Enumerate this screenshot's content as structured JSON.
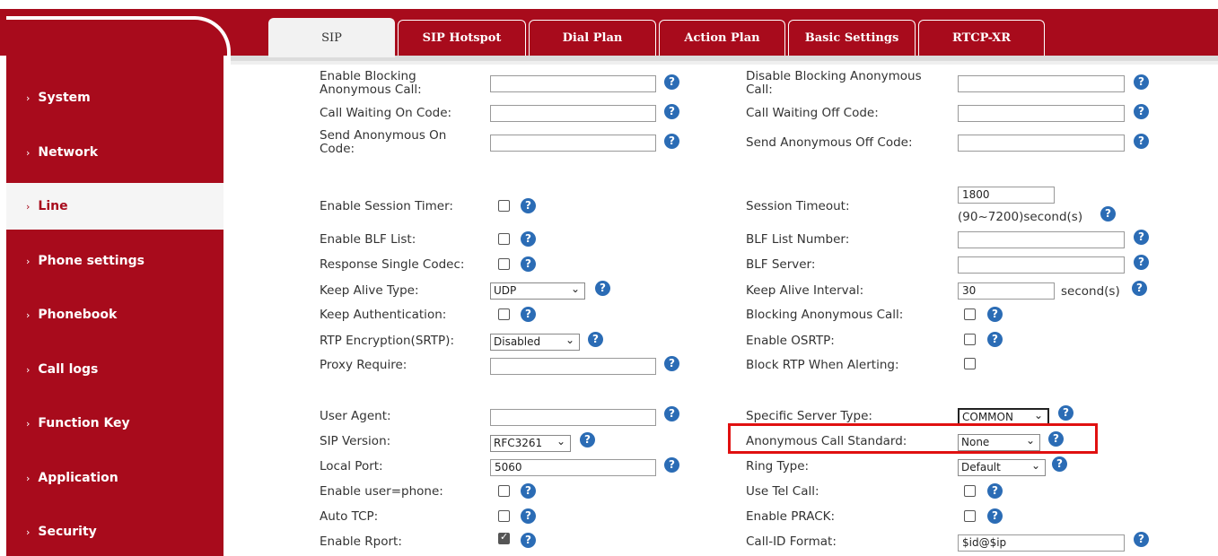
{
  "sidebar": {
    "items": [
      {
        "label": "System"
      },
      {
        "label": "Network"
      },
      {
        "label": "Line"
      },
      {
        "label": "Phone settings"
      },
      {
        "label": "Phonebook"
      },
      {
        "label": "Call logs"
      },
      {
        "label": "Function Key"
      },
      {
        "label": "Application"
      },
      {
        "label": "Security"
      }
    ],
    "active": "Line"
  },
  "tabs": [
    {
      "label": "SIP"
    },
    {
      "label": "SIP Hotspot"
    },
    {
      "label": "Dial Plan"
    },
    {
      "label": "Action Plan"
    },
    {
      "label": "Basic Settings"
    },
    {
      "label": "RTCP-XR"
    }
  ],
  "form": {
    "enable_blocking_anon_call": {
      "label_line1": "Enable Blocking",
      "label_line2": "Anonymous Call:",
      "value": ""
    },
    "disable_blocking_anon_call": {
      "label_line1": "Disable Blocking Anonymous",
      "label_line2": "Call:",
      "value": ""
    },
    "call_waiting_on_code": {
      "label": "Call Waiting On Code:",
      "value": ""
    },
    "call_waiting_off_code": {
      "label": "Call Waiting Off Code:",
      "value": ""
    },
    "send_anon_on_code": {
      "label_line1": "Send Anonymous On",
      "label_line2": "Code:",
      "value": ""
    },
    "send_anon_off_code": {
      "label": "Send Anonymous Off Code:",
      "value": ""
    },
    "enable_session_timer": {
      "label": "Enable Session Timer:",
      "checked": false
    },
    "session_timeout": {
      "label": "Session Timeout:",
      "value": "1800",
      "hint": "(90~7200)second(s)"
    },
    "enable_blf_list": {
      "label": "Enable BLF List:",
      "checked": false
    },
    "blf_list_number": {
      "label": "BLF List Number:",
      "value": ""
    },
    "response_single_codec": {
      "label": "Response Single Codec:",
      "checked": false
    },
    "blf_server": {
      "label": "BLF Server:",
      "value": ""
    },
    "keep_alive_type": {
      "label": "Keep Alive Type:",
      "value": "UDP"
    },
    "keep_alive_interval": {
      "label": "Keep Alive Interval:",
      "value": "30",
      "unit": "second(s)"
    },
    "keep_authentication": {
      "label": "Keep Authentication:",
      "checked": false
    },
    "blocking_anon_call": {
      "label": "Blocking Anonymous Call:",
      "checked": false
    },
    "rtp_encryption": {
      "label": "RTP Encryption(SRTP):",
      "value": "Disabled"
    },
    "enable_osrtp": {
      "label": "Enable OSRTP:",
      "checked": false
    },
    "proxy_require": {
      "label": "Proxy Require:",
      "value": ""
    },
    "block_rtp_alerting": {
      "label": "Block RTP When Alerting:",
      "checked": false
    },
    "user_agent": {
      "label": "User Agent:",
      "value": ""
    },
    "specific_server_type": {
      "label": "Specific Server Type:",
      "value": "COMMON"
    },
    "sip_version": {
      "label": "SIP Version:",
      "value": "RFC3261"
    },
    "anon_call_standard": {
      "label": "Anonymous Call Standard:",
      "value": "None"
    },
    "local_port": {
      "label": "Local Port:",
      "value": "5060"
    },
    "ring_type": {
      "label": "Ring Type:",
      "value": "Default"
    },
    "enable_user_phone": {
      "label": "Enable user=phone:",
      "checked": false
    },
    "use_tel_call": {
      "label": "Use Tel Call:",
      "checked": false
    },
    "auto_tcp": {
      "label": "Auto TCP:",
      "checked": false
    },
    "enable_prack": {
      "label": "Enable PRACK:",
      "checked": false
    },
    "enable_rport": {
      "label": "Enable Rport:",
      "checked": true
    },
    "call_id_format": {
      "label": "Call-ID Format:",
      "value": "$id@$ip"
    }
  },
  "help_glyph": "?",
  "arrow_glyph": "⌄",
  "chevron_glyph": "›",
  "colors": {
    "brand_red": "#a80b1c",
    "help_blue": "#2b6cb5",
    "highlight": "#e01010"
  }
}
